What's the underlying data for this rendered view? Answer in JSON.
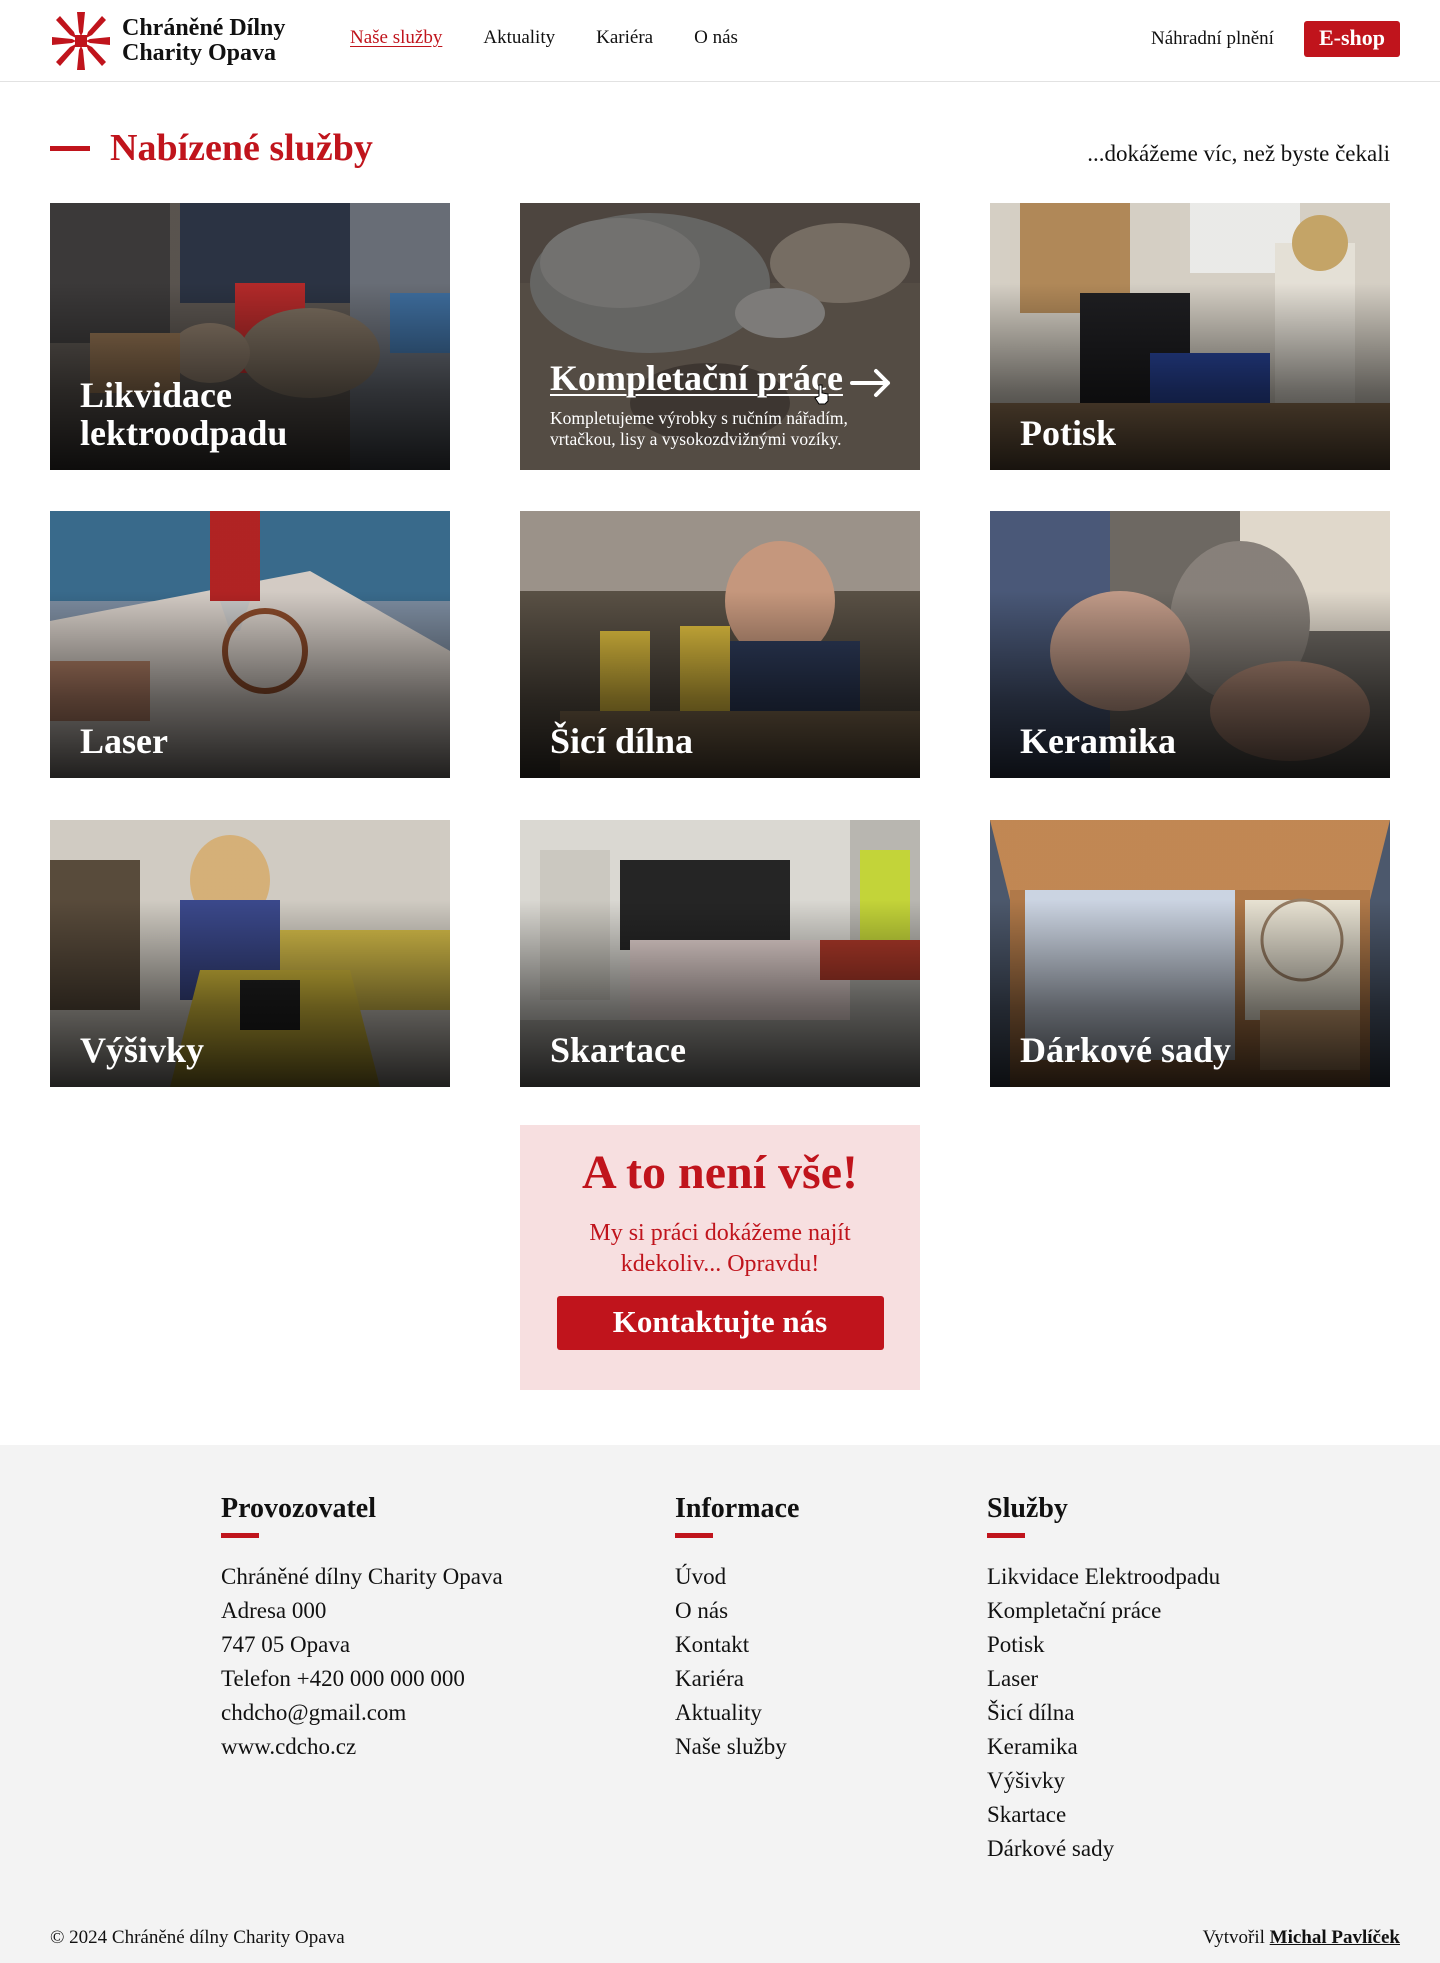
{
  "header": {
    "brand_line1": "Chráněné Dílny",
    "brand_line2": "Charity Opava",
    "nav": [
      "Naše služby",
      "Aktuality",
      "Kariéra",
      "O nás"
    ],
    "right_link": "Náhradní plnění",
    "eshop_label": "E-shop"
  },
  "colors": {
    "accent": "#c0141c",
    "promo_bg": "#f7dfe0",
    "footer_bg": "#f3f3f3"
  },
  "section": {
    "title": "Nabízené služby",
    "tagline": "...dokážeme víc, než byste čekali"
  },
  "tiles": [
    {
      "title": "Likvidace lektroodpadu"
    },
    {
      "title": "Kompletační práce",
      "description": "Kompletujeme výrobky s ručním nářadím, vrtačkou, lisy a vysokozdvižnými vozíky."
    },
    {
      "title": "Potisk"
    },
    {
      "title": "Laser"
    },
    {
      "title": "Šicí dílna"
    },
    {
      "title": "Keramika"
    },
    {
      "title": "Výšivky"
    },
    {
      "title": "Skartace"
    },
    {
      "title": "Dárkové sady"
    }
  ],
  "promo": {
    "title": "A to není vše!",
    "text": "My si práci dokážeme najít kdekoliv... Opravdu!",
    "button": "Kontaktujte nás"
  },
  "footer": {
    "col1": {
      "title": "Provozovatel",
      "lines": [
        "Chráněné dílny Charity Opava",
        "Adresa 000",
        "747 05 Opava",
        "Telefon +420 000 000 000",
        "chdcho@gmail.com",
        "www.cdcho.cz"
      ]
    },
    "col2": {
      "title": "Informace",
      "links": [
        "Úvod",
        "O nás",
        "Kontakt",
        "Kariéra",
        "Aktuality",
        "Naše služby"
      ]
    },
    "col3": {
      "title": "Služby",
      "links": [
        "Likvidace Elektroodpadu",
        "Kompletační práce",
        "Potisk",
        "Laser",
        "Šicí dílna",
        "Keramika",
        "Výšivky",
        "Skartace",
        "Dárkové sady"
      ]
    },
    "copyright": "© 2024 Chráněné dílny Charity Opava",
    "credits_prefix": "Vytvořil",
    "credits_name": "Michal Pavlíček"
  }
}
